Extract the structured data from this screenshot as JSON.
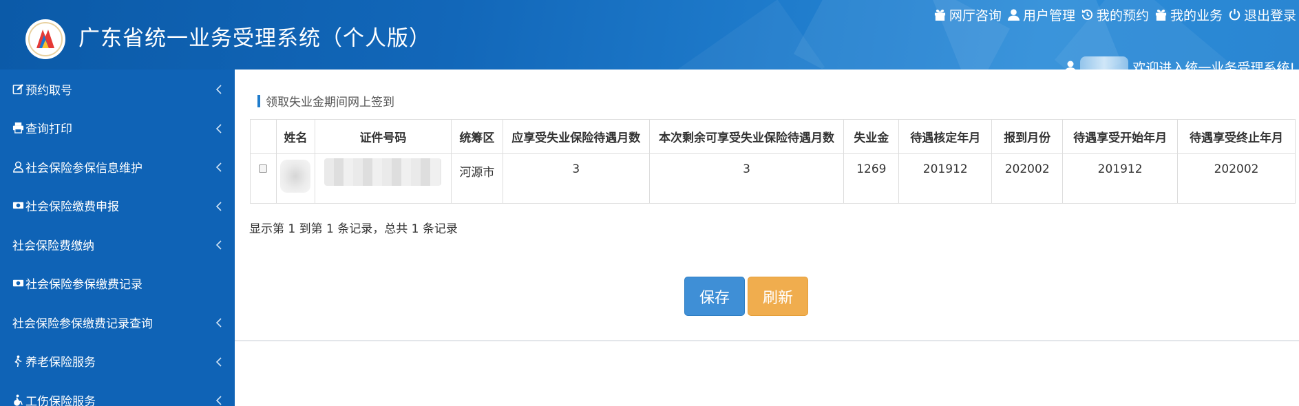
{
  "app": {
    "title": "广东省统一业务受理系统（个人版）"
  },
  "topnav": [
    {
      "label": "网厅咨询",
      "icon": "gift-icon"
    },
    {
      "label": "用户管理",
      "icon": "user-icon"
    },
    {
      "label": "我的预约",
      "icon": "history-icon"
    },
    {
      "label": "我的业务",
      "icon": "gift-icon"
    },
    {
      "label": "退出登录",
      "icon": "power-icon"
    }
  ],
  "welcome": {
    "text": ",欢迎进入统一业务受理系统!"
  },
  "sidebar": {
    "items": [
      {
        "label": "预约取号",
        "icon": "edit-icon",
        "expandable": true
      },
      {
        "label": "查询打印",
        "icon": "print-icon",
        "expandable": true
      },
      {
        "label": "社会保险参保信息维护",
        "icon": "user-icon",
        "expandable": true
      },
      {
        "label": "社会保险缴费申报",
        "icon": "money-icon",
        "expandable": true
      },
      {
        "label": "社会保险费缴纳",
        "icon": "",
        "expandable": true
      },
      {
        "label": "社会保险参保缴费记录",
        "icon": "money-icon",
        "expandable": false
      },
      {
        "label": "社会保险参保缴费记录查询",
        "icon": "",
        "expandable": true
      },
      {
        "label": "养老保险服务",
        "icon": "walking-icon",
        "expandable": true
      },
      {
        "label": "工伤保险服务",
        "icon": "wheelchair-icon",
        "expandable": true
      }
    ]
  },
  "main": {
    "section_title": "领取失业金期间网上签到",
    "table": {
      "headers": [
        "",
        "姓名",
        "证件号码",
        "统筹区",
        "应享受失业保险待遇月数",
        "本次剩余可享受失业保险待遇月数",
        "失业金",
        "待遇核定年月",
        "报到月份",
        "待遇享受开始年月",
        "待遇享受终止年月"
      ],
      "rows": [
        {
          "name": "",
          "id_number": "",
          "region": "河源市",
          "total_months": "3",
          "remaining_months": "3",
          "benefit": "1269",
          "approved_ym": "201912",
          "report_month": "202002",
          "start_ym": "201912",
          "end_ym": "202002"
        }
      ]
    },
    "pagination_info": "显示第 1 到第 1 条记录，总共 1 条记录",
    "buttons": {
      "save": "保存",
      "refresh": "刷新"
    }
  },
  "colors": {
    "header": "#1267b9",
    "sidebar": "#0f63b6",
    "primary": "#3f8fd6",
    "warning": "#f0ad4e"
  }
}
